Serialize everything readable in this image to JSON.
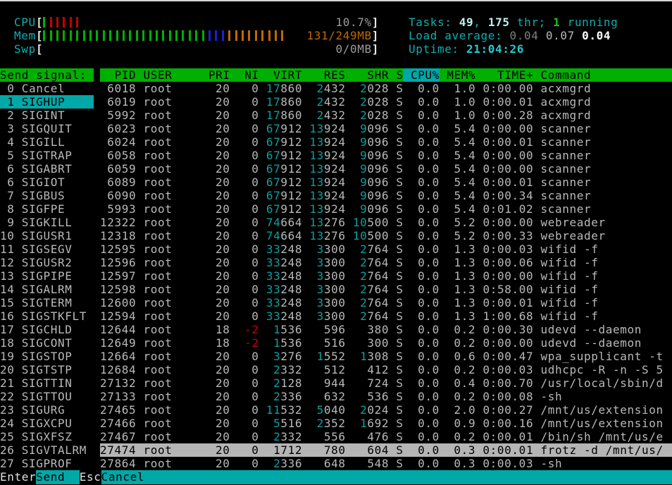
{
  "colors": {
    "accent_green": "#00b000",
    "accent_cyan": "#00a8a8",
    "selected_row_gray": "#b5b5b5",
    "text_gray": "#b9b9b9",
    "mem_number_cyan": "#0f9e9e",
    "nice_red": "#c40000",
    "meter_orange": "#c06800"
  },
  "header": {
    "meters": [
      {
        "label": "CPU",
        "value": "10.7%",
        "value_color": "gray",
        "ticks": [
          {
            "color": "green",
            "count": 1
          },
          {
            "color": "red",
            "count": 5
          }
        ]
      },
      {
        "label": "Mem",
        "value": "131/249MB",
        "value_color": "orange",
        "ticks": [
          {
            "color": "green",
            "count": 25
          },
          {
            "color": "blue",
            "count": 3
          },
          {
            "color": "orange",
            "count": 9
          }
        ]
      },
      {
        "label": "Swp",
        "value": "0/0MB",
        "value_color": "gray",
        "ticks": []
      }
    ],
    "tasks": {
      "label": "Tasks: ",
      "count": "49",
      "sep": ", ",
      "threads": "175",
      "thr_label": " thr; ",
      "running": "1",
      "running_label": " running"
    },
    "load": {
      "label": "Load average: ",
      "one": "0.04",
      "five": "0.07",
      "fifteen": "0.04"
    },
    "uptime": {
      "label": "Uptime: ",
      "value": "21:04:26"
    }
  },
  "signal_menu": {
    "title": "Send signal: ",
    "selected_index": 1,
    "items": [
      {
        "num": "0",
        "name": "Cancel"
      },
      {
        "num": "1",
        "name": "SIGHUP"
      },
      {
        "num": "2",
        "name": "SIGINT"
      },
      {
        "num": "3",
        "name": "SIGQUIT"
      },
      {
        "num": "4",
        "name": "SIGILL"
      },
      {
        "num": "5",
        "name": "SIGTRAP"
      },
      {
        "num": "6",
        "name": "SIGABRT"
      },
      {
        "num": "6",
        "name": "SIGIOT"
      },
      {
        "num": "7",
        "name": "SIGBUS"
      },
      {
        "num": "8",
        "name": "SIGFPE"
      },
      {
        "num": "9",
        "name": "SIGKILL"
      },
      {
        "num": "10",
        "name": "SIGUSR1"
      },
      {
        "num": "11",
        "name": "SIGSEGV"
      },
      {
        "num": "12",
        "name": "SIGUSR2"
      },
      {
        "num": "13",
        "name": "SIGPIPE"
      },
      {
        "num": "14",
        "name": "SIGALRM"
      },
      {
        "num": "15",
        "name": "SIGTERM"
      },
      {
        "num": "16",
        "name": "SIGSTKFLT"
      },
      {
        "num": "17",
        "name": "SIGCHLD"
      },
      {
        "num": "18",
        "name": "SIGCONT"
      },
      {
        "num": "19",
        "name": "SIGSTOP"
      },
      {
        "num": "20",
        "name": "SIGTSTP"
      },
      {
        "num": "21",
        "name": "SIGTTIN"
      },
      {
        "num": "22",
        "name": "SIGTTOU"
      },
      {
        "num": "23",
        "name": "SIGURG"
      },
      {
        "num": "24",
        "name": "SIGXCPU"
      },
      {
        "num": "25",
        "name": "SIGXFSZ"
      },
      {
        "num": "26",
        "name": "SIGVTALRM"
      },
      {
        "num": "27",
        "name": "SIGPROF"
      }
    ]
  },
  "table": {
    "columns": [
      "PID",
      "USER",
      "PRI",
      "NI",
      "VIRT",
      "RES",
      "SHR",
      "S",
      "CPU%",
      "MEM%",
      "TIME+",
      "Command"
    ],
    "sort_column": "CPU%",
    "selected_index": 27,
    "rows": [
      [
        "6018",
        "root",
        "20",
        "0",
        "17860",
        "2432",
        "2028",
        "S",
        "0.0",
        "1.0",
        "0:00.00",
        "acxmgrd"
      ],
      [
        "6019",
        "root",
        "20",
        "0",
        "17860",
        "2432",
        "2028",
        "S",
        "0.0",
        "1.0",
        "0:00.01",
        "acxmgrd"
      ],
      [
        "5992",
        "root",
        "20",
        "0",
        "17860",
        "2432",
        "2028",
        "S",
        "0.0",
        "1.0",
        "0:00.28",
        "acxmgrd"
      ],
      [
        "6023",
        "root",
        "20",
        "0",
        "67912",
        "13924",
        "9096",
        "S",
        "0.0",
        "5.4",
        "0:00.00",
        "scanner"
      ],
      [
        "6024",
        "root",
        "20",
        "0",
        "67912",
        "13924",
        "9096",
        "S",
        "0.0",
        "5.4",
        "0:00.01",
        "scanner"
      ],
      [
        "6058",
        "root",
        "20",
        "0",
        "67912",
        "13924",
        "9096",
        "S",
        "0.0",
        "5.4",
        "0:00.00",
        "scanner"
      ],
      [
        "6059",
        "root",
        "20",
        "0",
        "67912",
        "13924",
        "9096",
        "S",
        "0.0",
        "5.4",
        "0:00.00",
        "scanner"
      ],
      [
        "6089",
        "root",
        "20",
        "0",
        "67912",
        "13924",
        "9096",
        "S",
        "0.0",
        "5.4",
        "0:00.01",
        "scanner"
      ],
      [
        "6090",
        "root",
        "20",
        "0",
        "67912",
        "13924",
        "9096",
        "S",
        "0.0",
        "5.4",
        "0:00.34",
        "scanner"
      ],
      [
        "5993",
        "root",
        "20",
        "0",
        "67912",
        "13924",
        "9096",
        "S",
        "0.0",
        "5.4",
        "0:01.02",
        "scanner"
      ],
      [
        "12322",
        "root",
        "20",
        "0",
        "74664",
        "13276",
        "10500",
        "S",
        "0.0",
        "5.2",
        "0:00.00",
        "webreader"
      ],
      [
        "12318",
        "root",
        "20",
        "0",
        "74664",
        "13276",
        "10500",
        "S",
        "0.0",
        "5.2",
        "0:00.33",
        "webreader"
      ],
      [
        "12595",
        "root",
        "20",
        "0",
        "33248",
        "3300",
        "2764",
        "S",
        "0.0",
        "1.3",
        "0:00.03",
        "wifid -f"
      ],
      [
        "12596",
        "root",
        "20",
        "0",
        "33248",
        "3300",
        "2764",
        "S",
        "0.0",
        "1.3",
        "0:00.06",
        "wifid -f"
      ],
      [
        "12597",
        "root",
        "20",
        "0",
        "33248",
        "3300",
        "2764",
        "S",
        "0.0",
        "1.3",
        "0:00.00",
        "wifid -f"
      ],
      [
        "12598",
        "root",
        "20",
        "0",
        "33248",
        "3300",
        "2764",
        "S",
        "0.0",
        "1.3",
        "0:58.00",
        "wifid -f"
      ],
      [
        "12600",
        "root",
        "20",
        "0",
        "33248",
        "3300",
        "2764",
        "S",
        "0.0",
        "1.3",
        "0:00.01",
        "wifid -f"
      ],
      [
        "12594",
        "root",
        "20",
        "0",
        "33248",
        "3300",
        "2764",
        "S",
        "0.0",
        "1.3",
        "1:00.68",
        "wifid -f"
      ],
      [
        "12644",
        "root",
        "18",
        "-2",
        "1536",
        "596",
        "380",
        "S",
        "0.0",
        "0.2",
        "0:00.30",
        "udevd --daemon"
      ],
      [
        "12649",
        "root",
        "18",
        "-2",
        "1536",
        "516",
        "300",
        "S",
        "0.0",
        "0.2",
        "0:00.00",
        "udevd --daemon"
      ],
      [
        "12664",
        "root",
        "20",
        "0",
        "3276",
        "1552",
        "1308",
        "S",
        "0.0",
        "0.6",
        "0:00.47",
        "wpa_supplicant -t"
      ],
      [
        "12684",
        "root",
        "20",
        "0",
        "2332",
        "512",
        "412",
        "S",
        "0.0",
        "0.2",
        "0:00.03",
        "udhcpc -R -n -S 5"
      ],
      [
        "27132",
        "root",
        "20",
        "0",
        "2128",
        "944",
        "724",
        "S",
        "0.0",
        "0.4",
        "0:00.70",
        "/usr/local/sbin/d"
      ],
      [
        "27133",
        "root",
        "20",
        "0",
        "2336",
        "632",
        "536",
        "S",
        "0.0",
        "0.2",
        "0:00.08",
        "-sh"
      ],
      [
        "27465",
        "root",
        "20",
        "0",
        "11532",
        "5040",
        "2024",
        "S",
        "0.0",
        "2.0",
        "0:00.27",
        "/mnt/us/extension"
      ],
      [
        "27466",
        "root",
        "20",
        "0",
        "5516",
        "2352",
        "1692",
        "S",
        "0.0",
        "0.9",
        "0:00.16",
        "/mnt/us/extension"
      ],
      [
        "27467",
        "root",
        "20",
        "0",
        "2332",
        "556",
        "476",
        "S",
        "0.0",
        "0.2",
        "0:00.01",
        "/bin/sh /mnt/us/e"
      ],
      [
        "27474",
        "root",
        "20",
        "0",
        "1712",
        "780",
        "604",
        "S",
        "0.0",
        "0.3",
        "0:00.01",
        "frotz -d /mnt/us/"
      ],
      [
        "27864",
        "root",
        "20",
        "0",
        "2336",
        "648",
        "548",
        "S",
        "0.0",
        "0.3",
        "0:00.03",
        "-sh"
      ]
    ]
  },
  "footer": {
    "keys": [
      {
        "key": "Enter",
        "action": "Send  "
      },
      {
        "key": "Esc",
        "action": "Cancel"
      }
    ]
  }
}
